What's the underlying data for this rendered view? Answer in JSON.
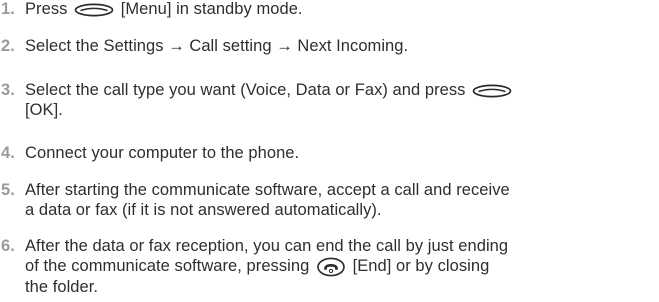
{
  "steps": [
    {
      "number": "1.",
      "line1_pre": "Press",
      "line1_icon": "menu-softkey-icon",
      "line1_post": "[Menu] in standby mode."
    },
    {
      "number": "2.",
      "line1": "Select the Settings → Call setting → Next Incoming."
    },
    {
      "number": "3.",
      "line1_pre": "Select the call type you want (Voice, Data or Fax) and press",
      "line1_icon": "ok-softkey-icon",
      "line2": "[OK]."
    },
    {
      "number": "4.",
      "line1": "Connect your computer to the phone."
    },
    {
      "number": "5.",
      "line1": "After starting the communicate software, accept a call and receive",
      "line2": "a data or fax (if it is not answered automatically)."
    },
    {
      "number": "6.",
      "line1": "After the data or fax reception, you can end the call by just ending",
      "line2_pre": "of the communicate software, pressing",
      "line2_icon": "end-key-icon",
      "line2_post": "[End] or by closing",
      "line3": "the folder."
    }
  ]
}
